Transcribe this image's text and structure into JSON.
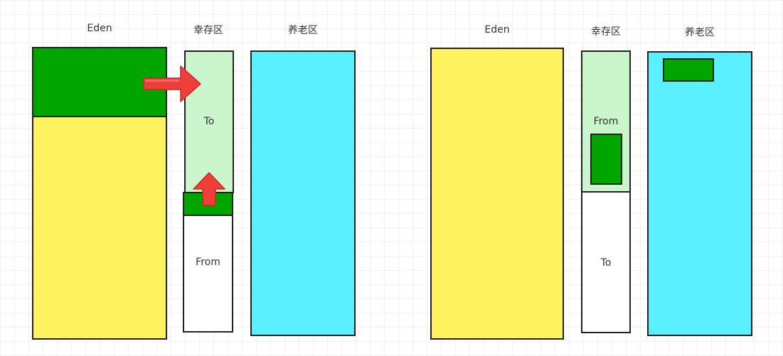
{
  "left_panel": {
    "eden_label": "Eden",
    "survivor_label": "幸存区",
    "old_label": "养老区",
    "to_label": "To",
    "from_label": "From"
  },
  "right_panel": {
    "eden_label": "Eden",
    "survivor_label": "幸存区",
    "old_label": "养老区",
    "from_label": "From",
    "to_label": "To"
  },
  "colors": {
    "eden": "#fff460",
    "survivor_active": "#cbf5cc",
    "survivor_empty": "#ffffff",
    "old": "#5bf0ff",
    "live_objects": "#00a500",
    "arrow": "#ef3f3a",
    "outline": "#222222"
  }
}
